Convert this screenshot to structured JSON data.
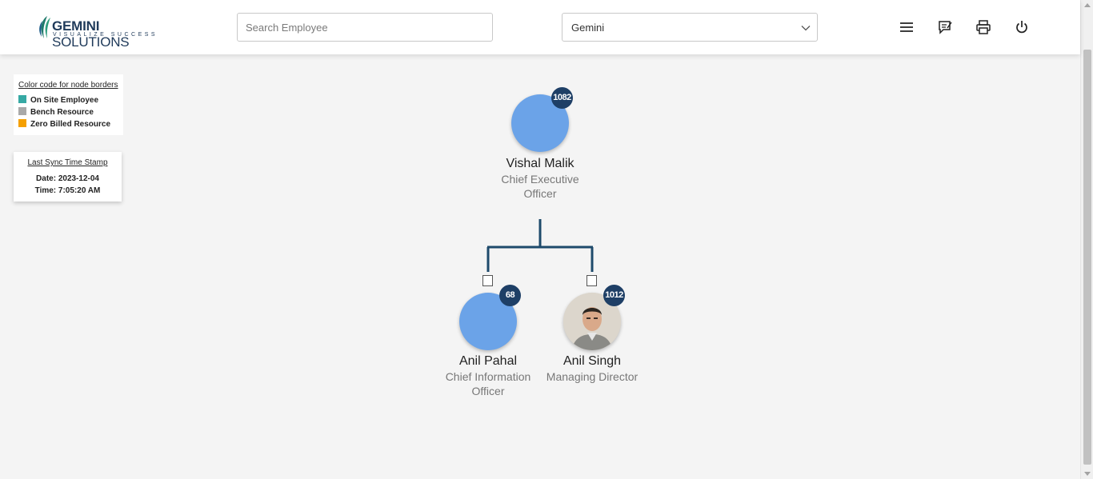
{
  "header": {
    "logo_main_bold": "GEMINI",
    "logo_main": " SOLUTIONS",
    "logo_tagline": "VISUALIZE SUCCESS",
    "search_placeholder": "Search Employee",
    "company_select_value": "Gemini",
    "icons": [
      "menu-icon",
      "feedback-icon",
      "print-icon",
      "power-icon"
    ]
  },
  "legend": {
    "title": "Color code for node borders",
    "items": [
      {
        "label": "On Site Employee",
        "color": "#36a9a4"
      },
      {
        "label": "Bench Resource",
        "color": "#a9a9a9"
      },
      {
        "label": "Zero Billed Resource",
        "color": "#f5a000"
      }
    ]
  },
  "sync": {
    "title": "Last Sync Time Stamp",
    "date": "Date: 2023-12-04",
    "time": "Time: 7:05:20 AM"
  },
  "org": {
    "root": {
      "name": "Vishal Malik",
      "title_line1": "Chief Executive",
      "title_line2": "Officer",
      "count": "1082"
    },
    "children": [
      {
        "name": "Anil Pahal",
        "title_line1": "Chief Information",
        "title_line2": "Officer",
        "count": "68"
      },
      {
        "name": "Anil Singh",
        "title_line1": "Managing Director",
        "title_line2": "",
        "count": "1012"
      }
    ]
  },
  "colors": {
    "connector": "#1e4a6b",
    "avatar_fill": "#6ba3e8",
    "badge_bg": "#1e3f66"
  }
}
